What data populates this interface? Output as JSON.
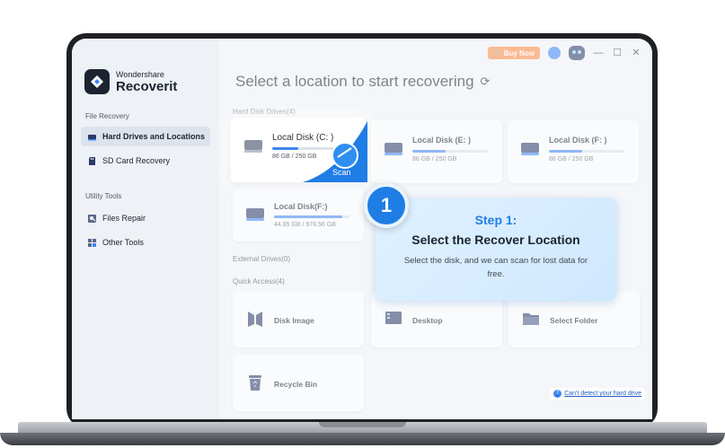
{
  "app": {
    "brand_sub": "Wondershare",
    "brand_main": "Recoverit"
  },
  "topbar": {
    "buy_label": "Buy Now",
    "minimize": "—",
    "maximize": "☐",
    "close": "✕"
  },
  "sidebar": {
    "section1": "File Recovery",
    "section2": "Utility Tools",
    "items": [
      {
        "label": "Hard Drives and Locations"
      },
      {
        "label": "SD Card Recovery"
      },
      {
        "label": "Files Repair"
      },
      {
        "label": "Other Tools"
      }
    ]
  },
  "main": {
    "title": "Select a location to start recovering",
    "hard_disk_label": "Hard Disk Drives(4)",
    "external_label": "External Drives(0)",
    "quick_access_label": "Quick Access(4)",
    "disks": [
      {
        "name": "Local Disk (C: )",
        "size": "86 GB / 250 GB",
        "used": 0.34
      },
      {
        "name": "Local Disk (E: )",
        "size": "86 GB / 250 GB",
        "used": 0.44
      },
      {
        "name": "Local Disk (F: )",
        "size": "86 GB / 250 GB",
        "used": 0.44
      },
      {
        "name": "Local Disk(F:)",
        "size": "44.85 GB / 976.56 GB",
        "used": 0.9
      }
    ],
    "quick_access": [
      {
        "label": "Disk Image"
      },
      {
        "label": "Desktop"
      },
      {
        "label": "Select Folder"
      },
      {
        "label": "Recycle Bin"
      }
    ],
    "scan_label": "Scan",
    "help_link": "Can't detect your hard drive"
  },
  "tutorial": {
    "badge": "1",
    "step": "Step 1:",
    "title": "Select the Recover Location",
    "desc": "Select the disk, and we can scan for lost data for free."
  },
  "colors": {
    "accent": "#1f7de6",
    "buy": "#ff8a3d",
    "bar": "#3e86f5"
  }
}
